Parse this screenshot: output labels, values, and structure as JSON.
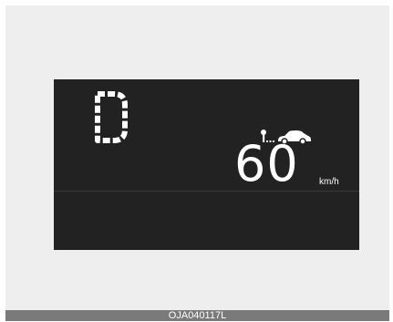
{
  "cluster": {
    "gear": "D",
    "speed": "60",
    "unit": "km/h",
    "icons": {
      "cruise": "cruise-control-vehicle-icon"
    }
  },
  "caption": "OJA040117L",
  "colors": {
    "display_bg": "#222222",
    "frame_bg": "#eeeeee",
    "caption_bar": "#7a7a7a",
    "text": "#ffffff"
  }
}
